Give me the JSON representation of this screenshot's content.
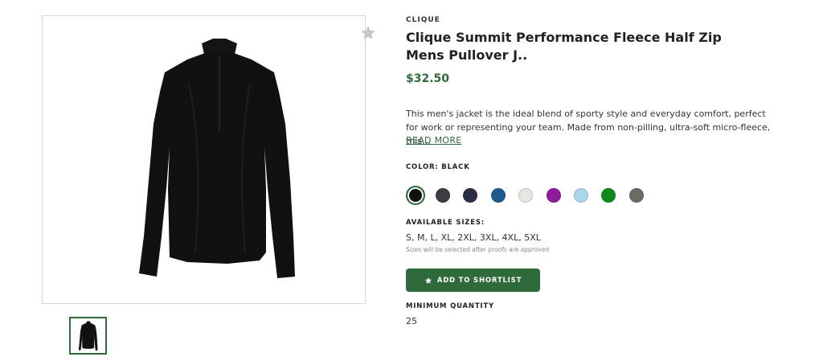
{
  "product": {
    "brand": "CLIQUE",
    "title": "Clique Summit Performance Fleece Half Zip Mens Pullover J..",
    "price": "$32.50",
    "description": "This men's jacket is the ideal blend of sporty style and everyday comfort, perfect for work or representing your team. Made from non-pilling, ultra-soft micro-fleece, this...",
    "read_more": "READ MORE"
  },
  "color": {
    "label": "COLOR: BLACK",
    "swatches": [
      {
        "name": "black",
        "hex": "#111111",
        "selected": true
      },
      {
        "name": "charcoal",
        "hex": "#3a3d44"
      },
      {
        "name": "navy",
        "hex": "#2a2f45"
      },
      {
        "name": "royal-blue",
        "hex": "#1f5a8e"
      },
      {
        "name": "light-grey",
        "hex": "#e6e6e2"
      },
      {
        "name": "purple",
        "hex": "#8e1a9c"
      },
      {
        "name": "light-blue",
        "hex": "#a9d6ea"
      },
      {
        "name": "green",
        "hex": "#0d8a1c"
      },
      {
        "name": "grey",
        "hex": "#6c6a62"
      }
    ]
  },
  "sizes": {
    "label": "AVAILABLE SIZES:",
    "values": "S, M, L, XL, 2XL, 3XL, 4XL, 5XL",
    "note": "Sizes will be selected after proofs are approved"
  },
  "actions": {
    "add_to_shortlist": "ADD TO SHORTLIST"
  },
  "minimum_quantity": {
    "label": "MINIMUM QUANTITY",
    "value": "25"
  },
  "icons": {
    "favorite": "star-icon",
    "shortlist": "star-icon"
  },
  "theme": {
    "accent": "#2f6b3a"
  }
}
